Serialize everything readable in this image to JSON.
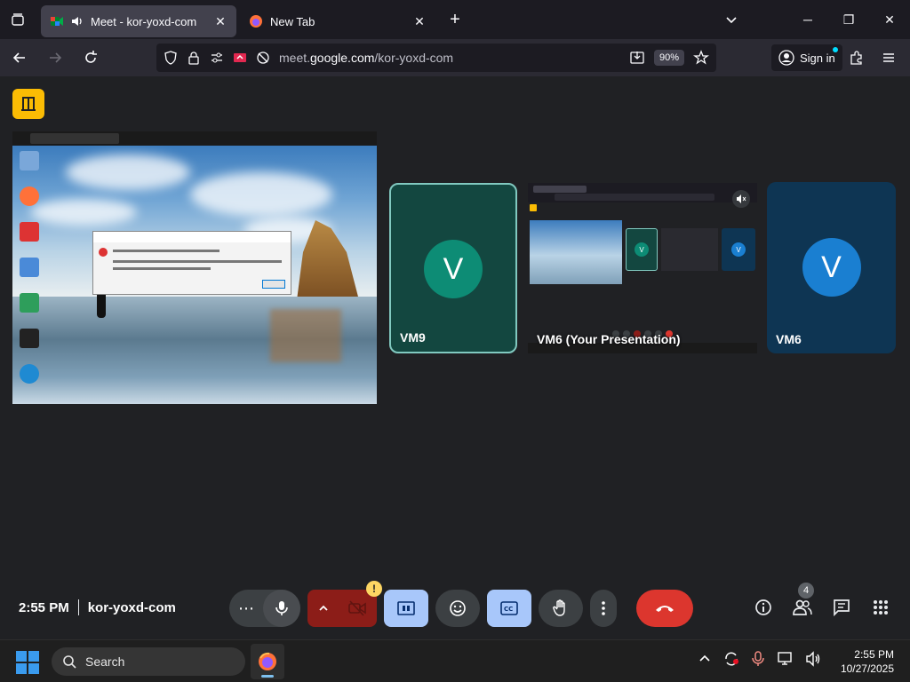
{
  "browser": {
    "tabs": [
      {
        "title": "Meet - kor-yoxd-com",
        "active": true
      },
      {
        "title": "New Tab",
        "active": false
      }
    ],
    "url_prefix": "meet.",
    "url_domain": "google.com",
    "url_path": "/kor-yoxd-com",
    "zoom": "90%",
    "signin_label": "Sign in"
  },
  "meet": {
    "tiles": [
      {
        "name": "VM9",
        "initial": "V"
      },
      {
        "name": "VM6 (Your Presentation)"
      },
      {
        "name": "VM6",
        "initial": "V"
      }
    ],
    "time": "2:55 PM",
    "meeting_code": "kor-yoxd-com",
    "people_count": "4",
    "camera_warning": "!"
  },
  "colors": {
    "end_call": "#dc362e",
    "camera_off": "#f2b8b5",
    "active_toggle": "#a8c7fa",
    "vm9_tile": "#134740",
    "vm6_tile": "#0e3553"
  },
  "taskbar": {
    "search_label": "Search",
    "time": "2:55 PM",
    "date": "10/27/2025"
  }
}
